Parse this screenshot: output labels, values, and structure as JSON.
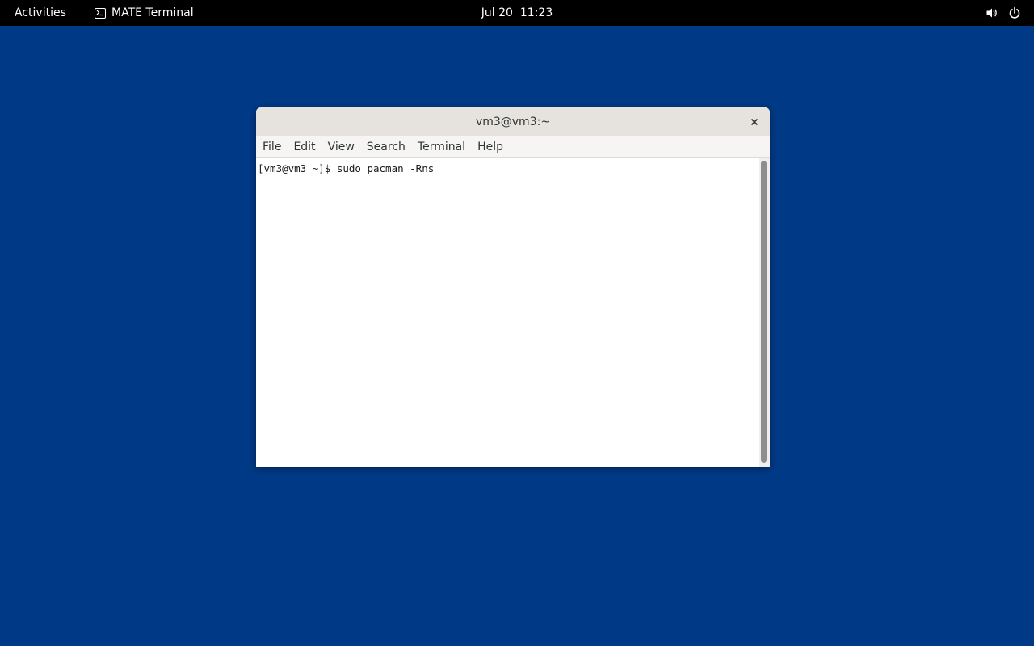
{
  "topbar": {
    "activities_label": "Activities",
    "app_name": "MATE Terminal",
    "app_icon": "terminal-icon",
    "date": "Jul 20",
    "time": "11:23",
    "tray_icons": [
      "volume-icon",
      "power-icon"
    ]
  },
  "window": {
    "title": "vm3@vm3:~",
    "close_icon": "close-icon",
    "menu": {
      "file": "File",
      "edit": "Edit",
      "view": "View",
      "search": "Search",
      "terminal": "Terminal",
      "help": "Help"
    },
    "terminal": {
      "prompt": "[vm3@vm3 ~]$ ",
      "command": "sudo pacman -Rns"
    }
  },
  "colors": {
    "desktop_background": "#003a87",
    "topbar_background": "#000000",
    "titlebar_background": "#e6e3df",
    "terminal_background": "#ffffff"
  }
}
